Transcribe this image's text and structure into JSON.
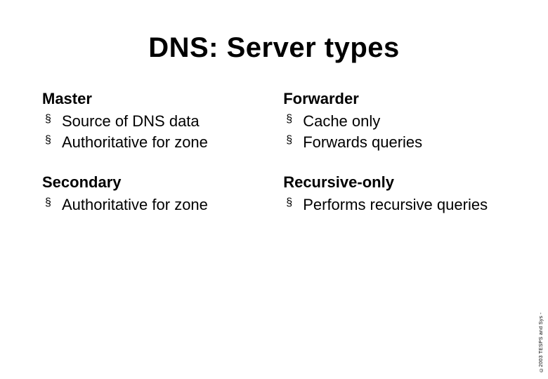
{
  "title": "DNS: Server types",
  "columns": {
    "left": {
      "block1": {
        "heading": "Master",
        "items": [
          "Source of DNS data",
          "Authoritative for zone"
        ]
      },
      "block2": {
        "heading": "Secondary",
        "items": [
          "Authoritative for zone"
        ]
      }
    },
    "right": {
      "block1": {
        "heading": "Forwarder",
        "items": [
          "Cache only",
          "Forwards queries"
        ]
      },
      "block2": {
        "heading": "Recursive-only",
        "items": [
          "Performs recursive queries"
        ]
      }
    }
  },
  "bullet_glyph": "§",
  "footer": "©2003 TESPS and Sys -"
}
